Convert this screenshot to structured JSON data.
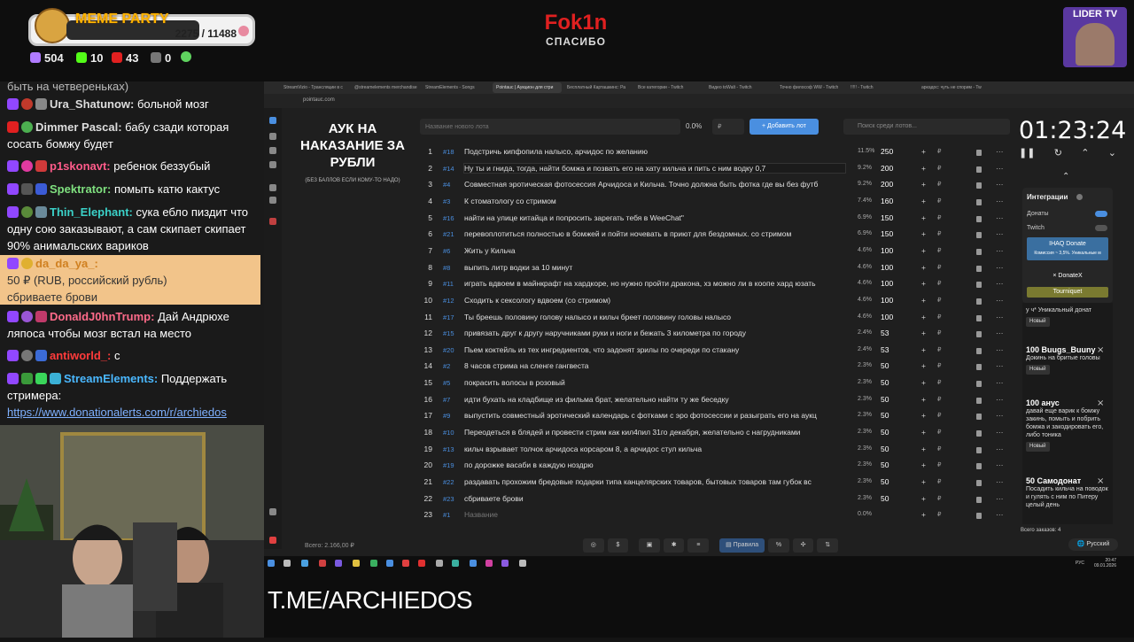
{
  "overlay": {
    "badge_title": "MEME PARTY",
    "badge_progress": "2275 / 11488",
    "stats": [
      "504",
      "10",
      "43",
      "0"
    ],
    "brand_name": "Fok1n",
    "brand_sub": "СПАСИБО",
    "lider": "LIDER TV",
    "bottom_text": "T.ME/ARCHIEDOS"
  },
  "chat": {
    "partial": "быть на четвереньках)",
    "messages": [
      {
        "user": "Ura_Shatunow:",
        "text": " больной мозг"
      },
      {
        "user": "Dimmer Pascal:",
        "text": " бабу сзади которая сосать бомжу будет"
      },
      {
        "user": "p1skonavt:",
        "text": " ребенок беззубый"
      },
      {
        "user": "Spektrator:",
        "text": " помыть катю кактус"
      },
      {
        "user": "Thin_Elephant:",
        "text": " сука ебло пиздит что одну сою заказывают, а сам скипает скипает 90% анимальских вариков"
      },
      {
        "user": "DonaldJ0hnTrump:",
        "text": " Дай Андрюхе ляпоса чтобы мозг встал на место"
      },
      {
        "user": "antiworld_:",
        "text": " с"
      },
      {
        "user": "StreamElements:",
        "text": " Поддержать стримера:"
      }
    ],
    "donation": {
      "user": "da_da_ya_:",
      "amount": "50 ₽ (RUB, российский рубль)",
      "text": "сбриваете брови"
    },
    "link": "https://www.donationalerts.com/r/archiedos"
  },
  "browser": {
    "tabs": [
      "StreamVizio - Трансляции в с",
      "@streamelements merchandise",
      "StreamElements - Songs",
      "Pointauc | Аукцион для стри",
      "Бесплатный Карташкинс: Ра",
      "Все категории - Twitch",
      "Видео toWalt - Twitch",
      "Точно философ WW - Twitch",
      "!!!!! - Twitch",
      "аркадос: чуть не спорим - Tw"
    ],
    "url": "pointauc.com"
  },
  "auction": {
    "title": "АУК НА НАКАЗАНИЕ ЗА РУБЛИ",
    "subtitle": "(БЕЗ БАЛЛОВ ЕСЛИ КОМУ-ТО НАДО)",
    "new_lot_placeholder": "Название нового лота",
    "new_lot_pct": "0.0%",
    "currency": "₽",
    "add_button": "Добавить лот",
    "search_placeholder": "Поиск среди лотов...",
    "total": "Всего: 2.166,00 ₽",
    "lots": [
      {
        "n": "1",
        "id": "#18",
        "name": "Подстричь кипфопила налысо, арчидос по желанию",
        "pct": "11.5%",
        "amount": "250"
      },
      {
        "n": "2",
        "id": "#14",
        "name": "Ну ты и гнида, тогда, найти бомжа и позвать его на хату кильча и пить с ним водку 0,7",
        "pct": "9.2%",
        "amount": "200"
      },
      {
        "n": "3",
        "id": "#4",
        "name": "Совместная эротическая фотосессия Арчидоса и Кильча. Точно должна быть фотка где вы без футб",
        "pct": "9.2%",
        "amount": "200"
      },
      {
        "n": "4",
        "id": "#3",
        "name": "К стоматологу со стримом",
        "pct": "7.4%",
        "amount": "160"
      },
      {
        "n": "5",
        "id": "#16",
        "name": "найти на улице китайца и попросить зарегать тебя в WeeChat\"",
        "pct": "6.9%",
        "amount": "150"
      },
      {
        "n": "6",
        "id": "#21",
        "name": "перевоплотиться полностью в бомжей и пойти ночевать в приют для бездомных. со стримом",
        "pct": "6.9%",
        "amount": "150"
      },
      {
        "n": "7",
        "id": "#6",
        "name": "Жить у Кильча",
        "pct": "4.6%",
        "amount": "100"
      },
      {
        "n": "8",
        "id": "#8",
        "name": "выпить литр водки за 10 минут",
        "pct": "4.6%",
        "amount": "100"
      },
      {
        "n": "9",
        "id": "#11",
        "name": "играть вдвоем в майнкрафт на хардкоре, но нужно пройти дракона, хз можно ли в коопе хард юзать",
        "pct": "4.6%",
        "amount": "100"
      },
      {
        "n": "10",
        "id": "#12",
        "name": "Сходить к сексологу вдвоем (со стримом)",
        "pct": "4.6%",
        "amount": "100"
      },
      {
        "n": "11",
        "id": "#17",
        "name": "Ты бреешь половину голову налысо и кильч бреет половину головы налысо",
        "pct": "4.6%",
        "amount": "100"
      },
      {
        "n": "12",
        "id": "#15",
        "name": "привязать друг к другу наручниками руки и ноги и бежать 3 километра по городу",
        "pct": "2.4%",
        "amount": "53"
      },
      {
        "n": "13",
        "id": "#20",
        "name": "Пьем коктейль из тех ингредиентов, что задонят зрилы по очереди по стакану",
        "pct": "2.4%",
        "amount": "53"
      },
      {
        "n": "14",
        "id": "#2",
        "name": "8 часов стрима на сленге гангвеста",
        "pct": "2.3%",
        "amount": "50"
      },
      {
        "n": "15",
        "id": "#5",
        "name": "покрасить волосы в розовый",
        "pct": "2.3%",
        "amount": "50"
      },
      {
        "n": "16",
        "id": "#7",
        "name": "идти бухать на кладбище из фильма брат, желательно найти ту же беседку",
        "pct": "2.3%",
        "amount": "50"
      },
      {
        "n": "17",
        "id": "#9",
        "name": "выпустить совместный эротический календарь с фотками с эро фотосессии и разыграть его на аукц",
        "pct": "2.3%",
        "amount": "50"
      },
      {
        "n": "18",
        "id": "#10",
        "name": "Переодеться в блядей и провести стрим как кил4пил 31го декабря, желательно с нагрудниками",
        "pct": "2.3%",
        "amount": "50"
      },
      {
        "n": "19",
        "id": "#13",
        "name": "кильч взрывает толчок арчидоса корсаром 8, а арчидос стул кильча",
        "pct": "2.3%",
        "amount": "50"
      },
      {
        "n": "20",
        "id": "#19",
        "name": "по дорожке васаби в каждую ноздрю",
        "pct": "2.3%",
        "amount": "50"
      },
      {
        "n": "21",
        "id": "#22",
        "name": "раздавать прохожим бредовые подарки типа канцелярских товаров,  бытовых товаров там губок вс",
        "pct": "2.3%",
        "amount": "50"
      },
      {
        "n": "22",
        "id": "#23",
        "name": "сбриваете брови",
        "pct": "2.3%",
        "amount": "50"
      },
      {
        "n": "23",
        "id": "#1",
        "name": "Название",
        "pct": "0.0%",
        "amount": ""
      }
    ]
  },
  "timer": "01:23:24",
  "integrations": {
    "title": "Интеграции",
    "donations": "Донаты",
    "twitch": "Twitch",
    "ihaq": "IHAQ Donate",
    "ihaq_sub": "Комиссия ~ 3,5%. Уникальные м",
    "donatex": "DonateX",
    "tourniquet": "Tourniquet"
  },
  "pending": [
    {
      "title": "",
      "text": "у ч* Уникальный донат",
      "tag": "Новый"
    },
    {
      "title": "100 Buugs_Buuny",
      "text": "Докинь на бритые головы",
      "tag": "Новый"
    },
    {
      "title": "100 анус",
      "text": "давай еще варик к бомжу закинь, помыть и побрить бомжа и закодировать его, либо тоника",
      "tag": "Новый"
    },
    {
      "title": "50 Самодонат",
      "text": "Посадить кильча на поводок и гулять с ним по Питеру целый день",
      "tag": "Новый"
    }
  ],
  "orders": "Всего заказов: 4",
  "lang": "Русский",
  "toolbar": {
    "rules": "Правила"
  },
  "clock": {
    "time": "20:47",
    "date": "09.01.2026",
    "kbd": "РУС"
  }
}
